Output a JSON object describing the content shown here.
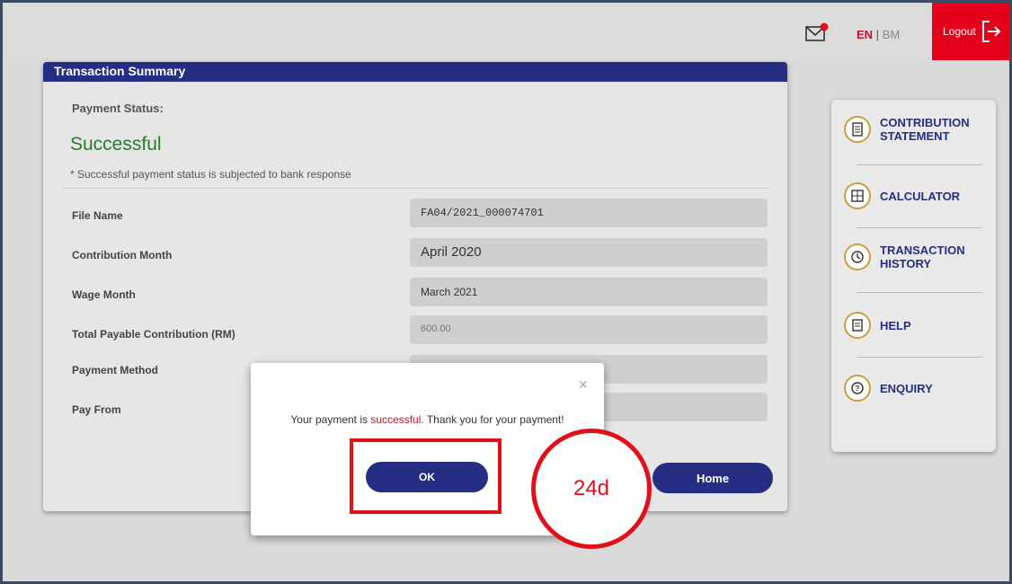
{
  "header": {
    "lang_en": "EN",
    "lang_sep": " | ",
    "lang_bm": "BM",
    "logout_label": "Logout",
    "mail_icon": "mail-icon",
    "logout_icon": "logout-icon"
  },
  "summary": {
    "title": "Transaction Summary",
    "payment_status_label": "Payment Status:",
    "payment_status_value": "Successful",
    "note": "* Successful payment status is subjected to bank response",
    "rows": [
      {
        "label": "File Name",
        "value": "FA04/2021_000074701"
      },
      {
        "label": "Contribution Month",
        "value": "April 2020"
      },
      {
        "label": "Wage Month",
        "value": "March 2021"
      },
      {
        "label": "Total Payable Contribution (RM)",
        "value": "600.00"
      },
      {
        "label": "Payment Method",
        "value": ""
      },
      {
        "label": "Pay From",
        "value": ""
      }
    ],
    "home_label": "Home"
  },
  "sidemenu": {
    "items": [
      {
        "label": "CONTRIBUTION STATEMENT",
        "icon": "statement-icon"
      },
      {
        "label": "CALCULATOR",
        "icon": "calculator-icon"
      },
      {
        "label": "TRANSACTION HISTORY",
        "icon": "history-icon"
      },
      {
        "label": "HELP",
        "icon": "help-icon"
      },
      {
        "label": "ENQUIRY",
        "icon": "enquiry-icon"
      }
    ]
  },
  "modal": {
    "close_glyph": "×",
    "msg_prefix": "Your payment is ",
    "msg_highlight": "successful",
    "msg_suffix": ". Thank you for your payment!",
    "ok_label": "OK"
  },
  "annotation": {
    "callout_text": "24d"
  },
  "colors": {
    "brand_navy": "#262e84",
    "logout_red": "#e4001b",
    "success_green": "#2b7a2b",
    "annotation_red": "#e0101b"
  }
}
